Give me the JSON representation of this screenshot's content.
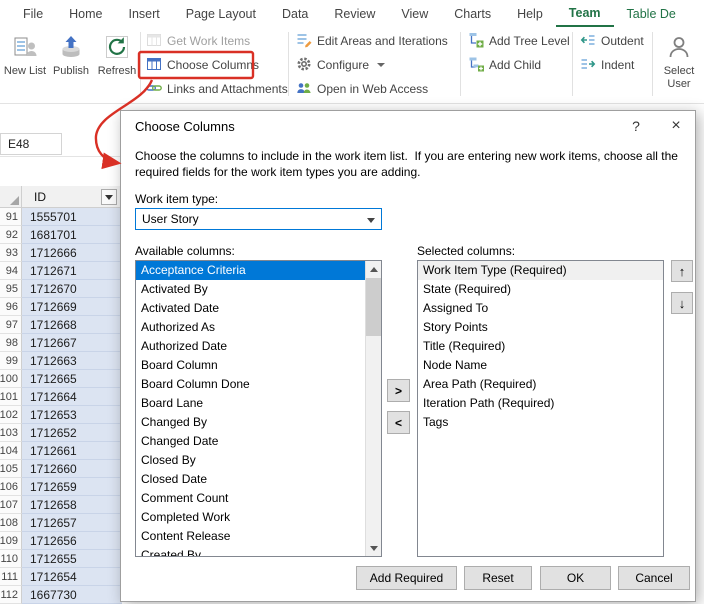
{
  "ribbon": {
    "tabs": [
      "File",
      "Home",
      "Insert",
      "Page Layout",
      "Data",
      "Review",
      "View",
      "Charts",
      "Help",
      "Team",
      "Table De"
    ],
    "buttons": {
      "new_list": "New List",
      "publish": "Publish",
      "refresh": "Refresh",
      "get_work_items": "Get Work Items",
      "choose_columns": "Choose Columns",
      "links_and_attachments": "Links and Attachments",
      "edit_areas_and_iterations": "Edit Areas and Iterations",
      "configure": "Configure",
      "open_in_web_access": "Open in Web Access",
      "add_tree_level": "Add Tree Level",
      "add_child": "Add Child",
      "outdent": "Outdent",
      "indent": "Indent",
      "select_user": "Select User"
    },
    "accent_color": "#217346"
  },
  "name_box": "E48",
  "grid": {
    "column_header": "ID",
    "selection_color": "#dce4f2",
    "rows": [
      {
        "n": "91",
        "id": "1555701"
      },
      {
        "n": "92",
        "id": "1681701"
      },
      {
        "n": "93",
        "id": "1712666"
      },
      {
        "n": "94",
        "id": "1712671"
      },
      {
        "n": "95",
        "id": "1712670"
      },
      {
        "n": "96",
        "id": "1712669"
      },
      {
        "n": "97",
        "id": "1712668"
      },
      {
        "n": "98",
        "id": "1712667"
      },
      {
        "n": "99",
        "id": "1712663"
      },
      {
        "n": "100",
        "id": "1712665"
      },
      {
        "n": "101",
        "id": "1712664"
      },
      {
        "n": "102",
        "id": "1712653"
      },
      {
        "n": "103",
        "id": "1712652"
      },
      {
        "n": "104",
        "id": "1712661"
      },
      {
        "n": "105",
        "id": "1712660"
      },
      {
        "n": "106",
        "id": "1712659"
      },
      {
        "n": "107",
        "id": "1712658"
      },
      {
        "n": "108",
        "id": "1712657"
      },
      {
        "n": "109",
        "id": "1712656"
      },
      {
        "n": "110",
        "id": "1712655"
      },
      {
        "n": "111",
        "id": "1712654"
      },
      {
        "n": "112",
        "id": "1667730"
      }
    ]
  },
  "dialog": {
    "title": "Choose Columns",
    "description": "Choose the columns to include in the work item list.  If you are entering new work items, choose all the required fields for the work item types you are adding.",
    "work_item_type_label": "Work item type:",
    "work_item_type": "User Story",
    "available_label": "Available columns:",
    "selected_label": "Selected columns:",
    "available_columns": [
      "Acceptance Criteria",
      "Activated By",
      "Activated Date",
      "Authorized As",
      "Authorized Date",
      "Board Column",
      "Board Column Done",
      "Board Lane",
      "Changed By",
      "Changed Date",
      "Closed By",
      "Closed Date",
      "Comment Count",
      "Completed Work",
      "Content Release",
      "Created By"
    ],
    "selected_columns": [
      "Work Item Type (Required)",
      "State (Required)",
      "Assigned To",
      "Story Points",
      "Title (Required)",
      "Node Name",
      "Area Path (Required)",
      "Iteration Path (Required)",
      "Tags"
    ],
    "buttons": {
      "help": "?",
      "close": "×",
      "move_right": ">",
      "move_left": "<",
      "move_up": "↑",
      "move_down": "↓",
      "add_required": "Add Required",
      "reset": "Reset",
      "ok": "OK",
      "cancel": "Cancel"
    },
    "highlight_color": "#0078d7"
  },
  "annotation_color": "#d93025"
}
